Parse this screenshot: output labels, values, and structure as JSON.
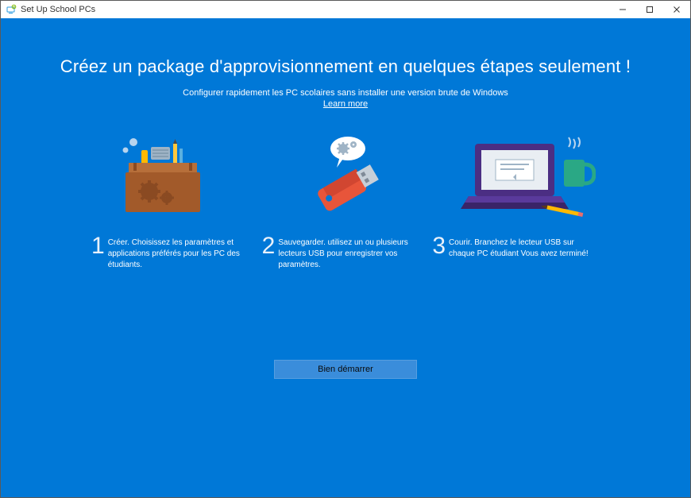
{
  "window": {
    "title": "Set Up School PCs"
  },
  "main": {
    "headline": "Créez un package d'approvisionnement en quelques étapes seulement !",
    "subhead": "Configurer rapidement les PC scolaires sans installer une version brute de Windows",
    "learn_more": "Learn more",
    "steps": [
      {
        "num": "1",
        "text": "Créer. Choisissez les paramètres et applications préférés pour les PC des étudiants."
      },
      {
        "num": "2",
        "text": "Sauvegarder. utilisez un ou plusieurs lecteurs USB pour enregistrer vos paramètres."
      },
      {
        "num": "3",
        "text": "Courir. Branchez le lecteur USB sur chaque PC étudiant Vous avez terminé!"
      }
    ],
    "get_started": "Bien démarrer"
  }
}
